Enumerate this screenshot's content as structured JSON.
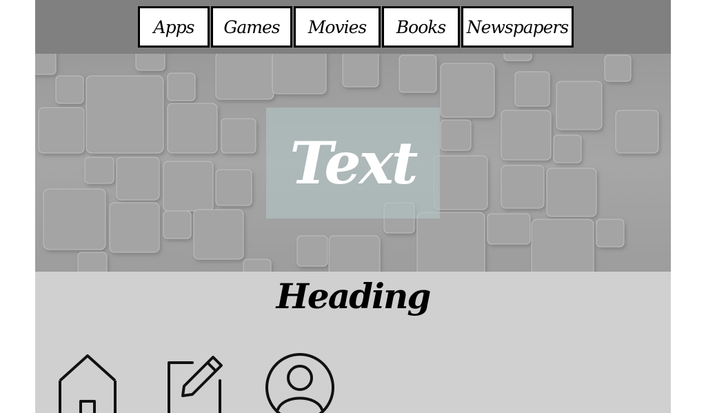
{
  "nav": {
    "items": [
      {
        "label": "Apps"
      },
      {
        "label": "Games"
      },
      {
        "label": "Movies"
      },
      {
        "label": "Books"
      },
      {
        "label": "Newspapers"
      }
    ]
  },
  "hero": {
    "text": "Text"
  },
  "main": {
    "heading": "Heading",
    "icons": [
      {
        "icon": "home-icon"
      },
      {
        "icon": "edit-icon"
      },
      {
        "icon": "user-icon"
      }
    ]
  },
  "colors": {
    "page_background": "#d0d0d0",
    "topbar": "#808080",
    "nav_item_background": "#ffffff",
    "nav_item_border": "#000000",
    "hero_text": "#ffffff"
  }
}
